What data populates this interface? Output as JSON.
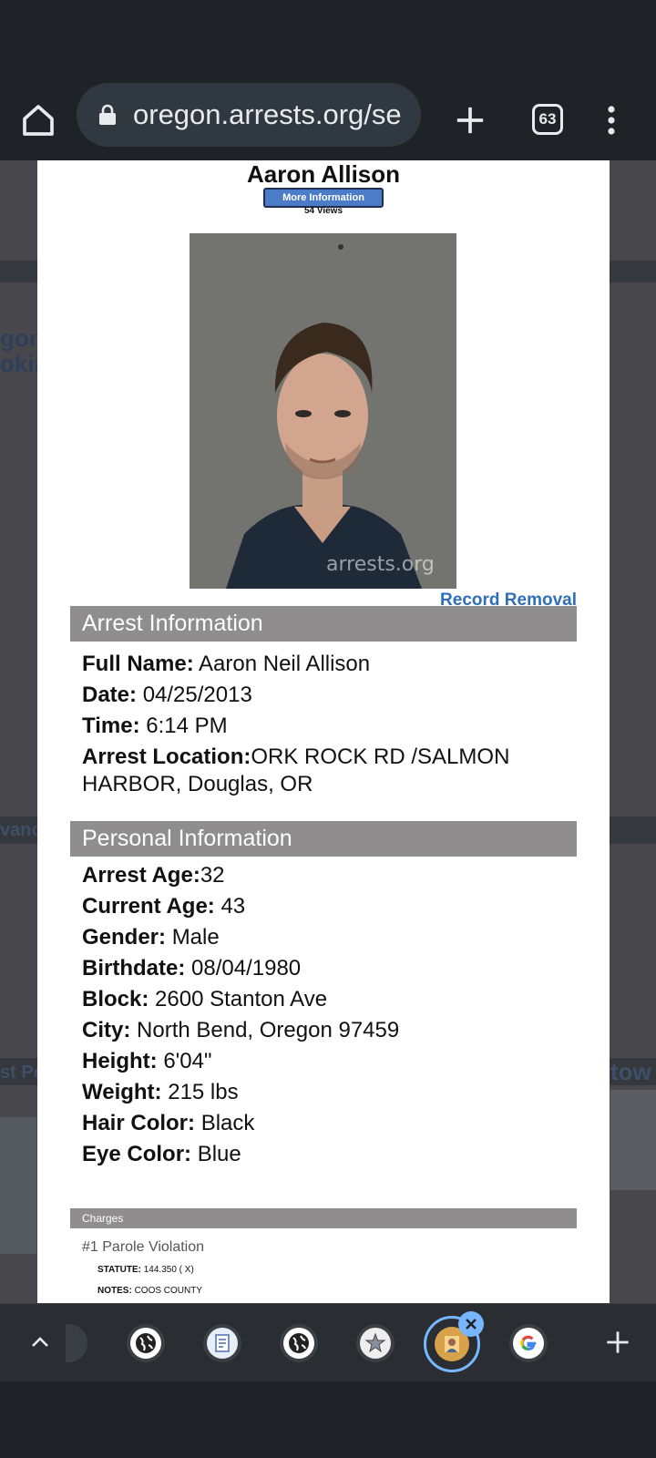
{
  "browser": {
    "url": "oregon.arrests.org/se",
    "tab_count": "63"
  },
  "modal": {
    "name": "Aaron Allison",
    "more_info_label": "More Information",
    "views": "54 Views",
    "record_removal": "Record Removal",
    "arrest_section": {
      "title": "Arrest Information",
      "full_name_label": "Full Name:",
      "full_name": "Aaron Neil Allison",
      "date_label": "Date:",
      "date": "04/25/2013",
      "time_label": "Time:",
      "time": "6:14 PM",
      "location_label": "Arrest Location:",
      "location": "ORK ROCK RD /SALMON HARBOR, Douglas, OR"
    },
    "personal_section": {
      "title": "Personal Information",
      "arrest_age_label": "Arrest Age:",
      "arrest_age": "32",
      "current_age_label": "Current Age:",
      "current_age": "43",
      "gender_label": "Gender:",
      "gender": "Male",
      "birthdate_label": "Birthdate:",
      "birthdate": "08/04/1980",
      "block_label": "Block:",
      "block": "2600 Stanton Ave",
      "city_label": "City:",
      "city": "North Bend, Oregon 97459",
      "height_label": "Height:",
      "height": "6'04\"",
      "weight_label": "Weight:",
      "weight": "215 lbs",
      "hair_label": "Hair Color:",
      "hair": "Black",
      "eye_label": "Eye Color:",
      "eye": "Blue"
    },
    "charges": {
      "title": "Charges",
      "items": [
        {
          "title": "#1 Parole Violation",
          "statute_label": "STATUTE:",
          "statute": "144.350 ( X)",
          "notes_label": "NOTES:",
          "notes": "COOS COUNTY"
        }
      ]
    },
    "photo_watermark": "arrests.org"
  },
  "icons": {
    "home": "home-icon",
    "lock": "lock-icon",
    "new_tab": "plus-icon",
    "tabs": "tab-switcher-icon",
    "menu": "more-vert-icon",
    "up": "chevron-up-icon",
    "close": "close-icon",
    "add": "plus-icon"
  }
}
